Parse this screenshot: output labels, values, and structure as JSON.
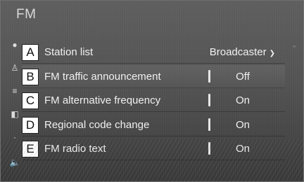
{
  "header": {
    "title": "FM"
  },
  "rows": [
    {
      "letter": "A",
      "label": "Station list",
      "value": "Broadcaster"
    },
    {
      "letter": "B",
      "label": "FM traffic announcement",
      "value": "Off"
    },
    {
      "letter": "C",
      "label": "FM alternative frequency",
      "value": "On"
    },
    {
      "letter": "D",
      "label": "Regional code change",
      "value": "On"
    },
    {
      "letter": "E",
      "label": "FM radio text",
      "value": "On"
    }
  ],
  "icons": {
    "dropdown": "chevron-down-icon",
    "scroll": "chevron-up-icon",
    "side_rail": [
      "radio-icon",
      "antenna-icon",
      "list-icon",
      "tune-icon",
      "dot-icon",
      "volume-icon"
    ]
  },
  "colors": {
    "background": "#555555",
    "text": "#f0f0f0",
    "callout_box": "#ffffff"
  }
}
